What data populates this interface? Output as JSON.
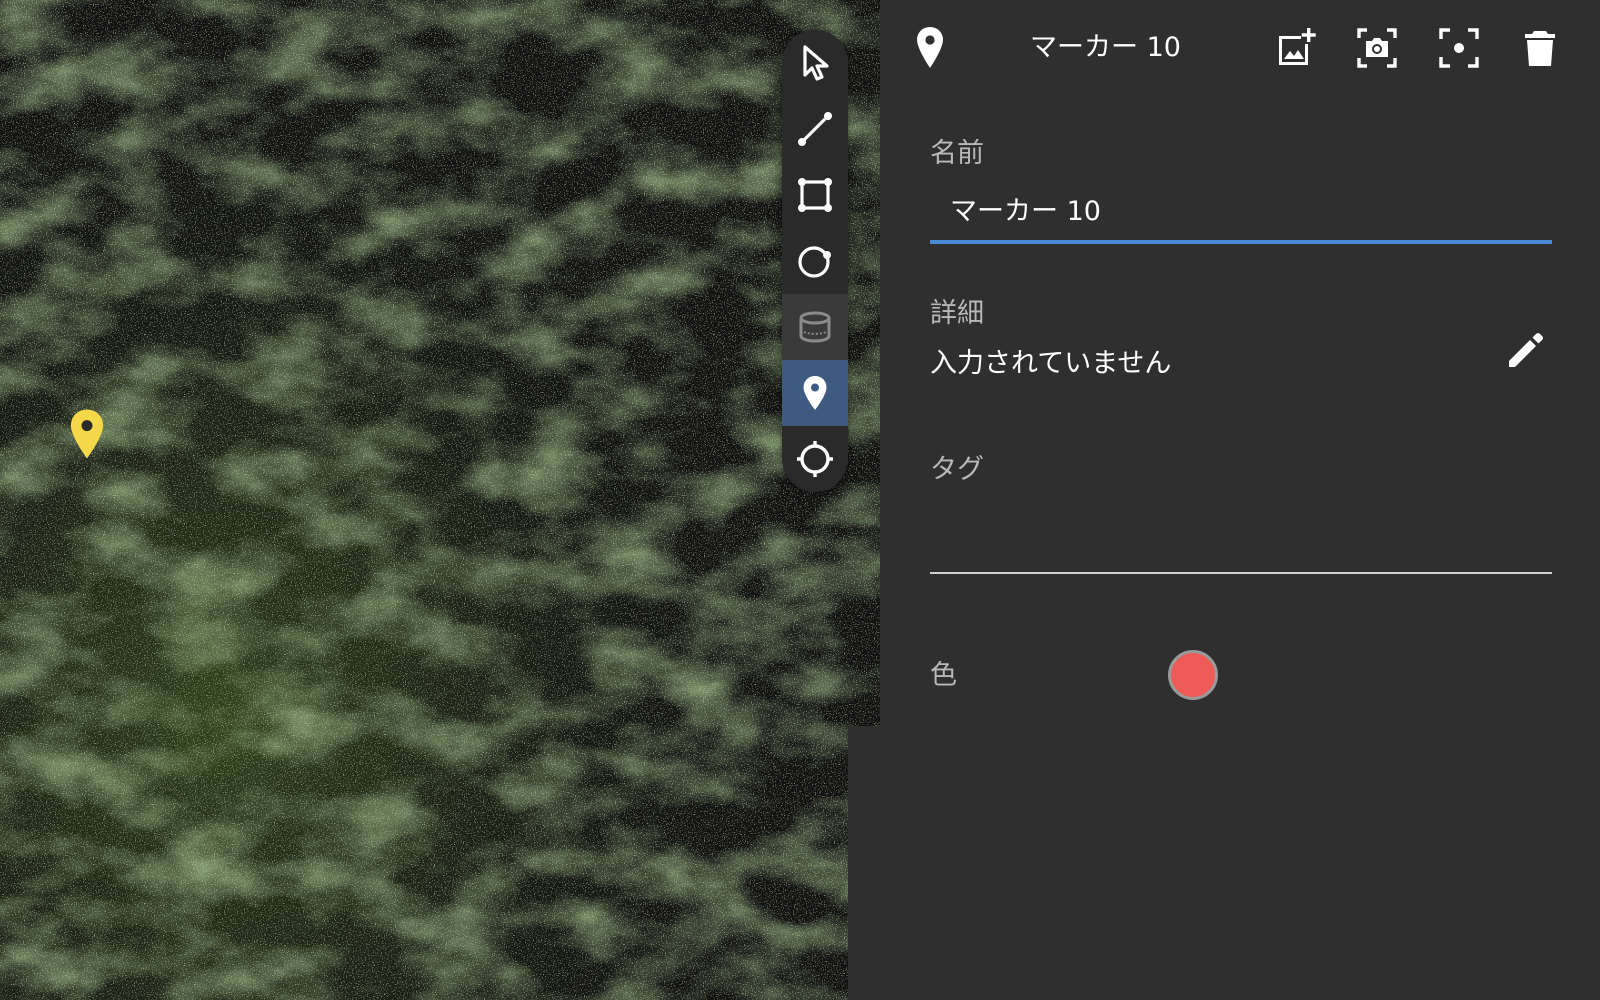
{
  "header": {
    "title": "マーカー 10",
    "icon": "marker-pin-icon",
    "actions": [
      {
        "name": "add-image-button",
        "icon": "image-add-icon"
      },
      {
        "name": "screenshot-button",
        "icon": "camera-icon"
      },
      {
        "name": "focus-button",
        "icon": "center-focus-icon"
      },
      {
        "name": "delete-button",
        "icon": "trash-icon"
      }
    ]
  },
  "form": {
    "name_label": "名前",
    "name_value": "マーカー 10",
    "detail_label": "詳細",
    "detail_value": "入力されていません",
    "tag_label": "タグ",
    "tag_value": "",
    "color_label": "色"
  },
  "colors": {
    "accent": "#4a8ad8",
    "marker_color": "#ee5a55",
    "viewport_marker": "#f5d84a",
    "active_tool": "#3f5a80",
    "panel_bg": "#2f2f2f"
  },
  "tools": [
    {
      "name": "select-tool",
      "icon": "cursor-arrow-icon",
      "state": "normal"
    },
    {
      "name": "line-tool",
      "icon": "line-segment-icon",
      "state": "normal"
    },
    {
      "name": "rectangle-tool",
      "icon": "rectangle-vertices-icon",
      "state": "normal"
    },
    {
      "name": "circle-tool",
      "icon": "circle-point-icon",
      "state": "normal"
    },
    {
      "name": "volume-tool",
      "icon": "cylinder-icon",
      "state": "disabled"
    },
    {
      "name": "marker-tool",
      "icon": "marker-pin-icon",
      "state": "active"
    },
    {
      "name": "crosshair-tool",
      "icon": "crosshair-icon",
      "state": "normal"
    }
  ]
}
